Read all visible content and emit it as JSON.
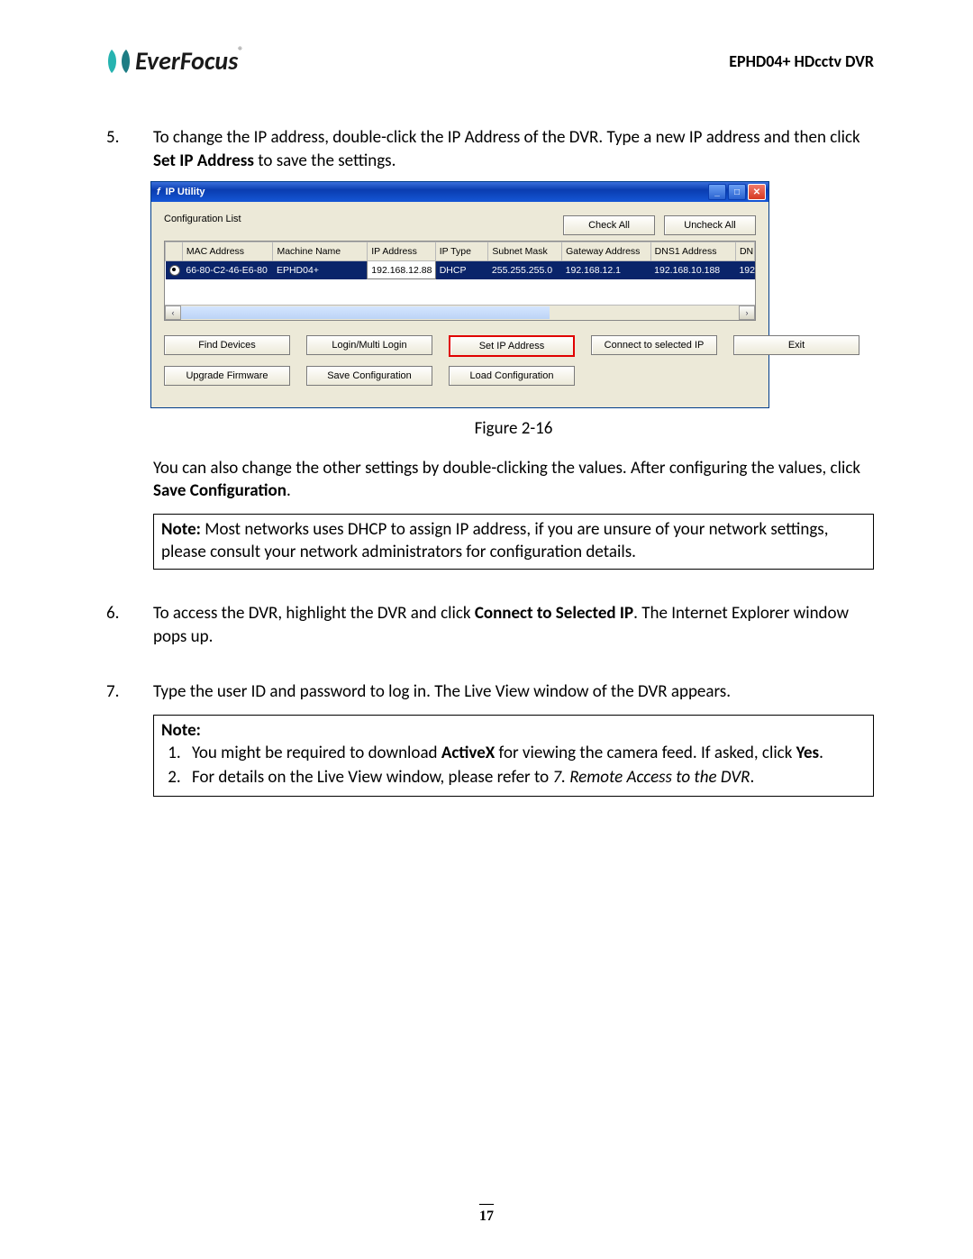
{
  "header": {
    "logo_text": "EverFocus",
    "product": "EPHD04+  HDcctv DVR"
  },
  "steps": {
    "s5": {
      "num": "5.",
      "text_a": "To change the IP address, double-click the IP Address of the DVR. Type a new IP address and then click ",
      "bold": "Set IP Address",
      "text_b": " to save the settings.",
      "figure_caption": "Figure 2-16",
      "post_a": "You can also change the other settings by double-clicking the values. After configuring the values, click ",
      "post_bold": "Save Configuration",
      "post_b": ".",
      "note_label": "Note:",
      "note_text": " Most networks uses DHCP to assign IP address, if you are unsure of your network settings, please consult your network administrators for configuration details."
    },
    "s6": {
      "num": "6.",
      "text_a": "To access the DVR, highlight the DVR and click ",
      "bold": "Connect to Selected IP",
      "text_b": ". The Internet Explorer window pops up."
    },
    "s7": {
      "num": "7.",
      "text": "Type the user ID and password to log in. The Live View window of the DVR appears.",
      "note_label": "Note:",
      "n1_a": "You might be required to download ",
      "n1_b1": "ActiveX",
      "n1_c": " for viewing the camera feed. If asked, click ",
      "n1_b2": "Yes",
      "n1_d": ".",
      "n2_a": "For details on the Live View window, please refer to ",
      "n2_i": "7. Remote Access to the DVR",
      "n2_b": "."
    }
  },
  "ipwin": {
    "title": "IP Utility",
    "config_list": "Configuration List",
    "check_all": "Check All",
    "uncheck_all": "Uncheck All",
    "columns": {
      "mac": "MAC Address",
      "machine": "Machine Name",
      "ip": "IP Address",
      "type": "IP Type",
      "subnet": "Subnet Mask",
      "gateway": "Gateway Address",
      "dns1": "DNS1 Address",
      "dns2": "DN"
    },
    "row": {
      "mac": "66-80-C2-46-E6-80",
      "machine": "EPHD04+",
      "ip": "192.168.12.88",
      "type": "DHCP",
      "subnet": "255.255.255.0",
      "gateway": "192.168.12.1",
      "dns1": "192.168.10.188",
      "dns2": "192"
    },
    "buttons": {
      "find": "Find Devices",
      "login": "Login/Multi Login",
      "setip": "Set IP Address",
      "connect": "Connect to selected IP",
      "exit": "Exit",
      "upgrade": "Upgrade Firmware",
      "save": "Save Configuration",
      "load": "Load Configuration"
    }
  },
  "page_number": "17"
}
